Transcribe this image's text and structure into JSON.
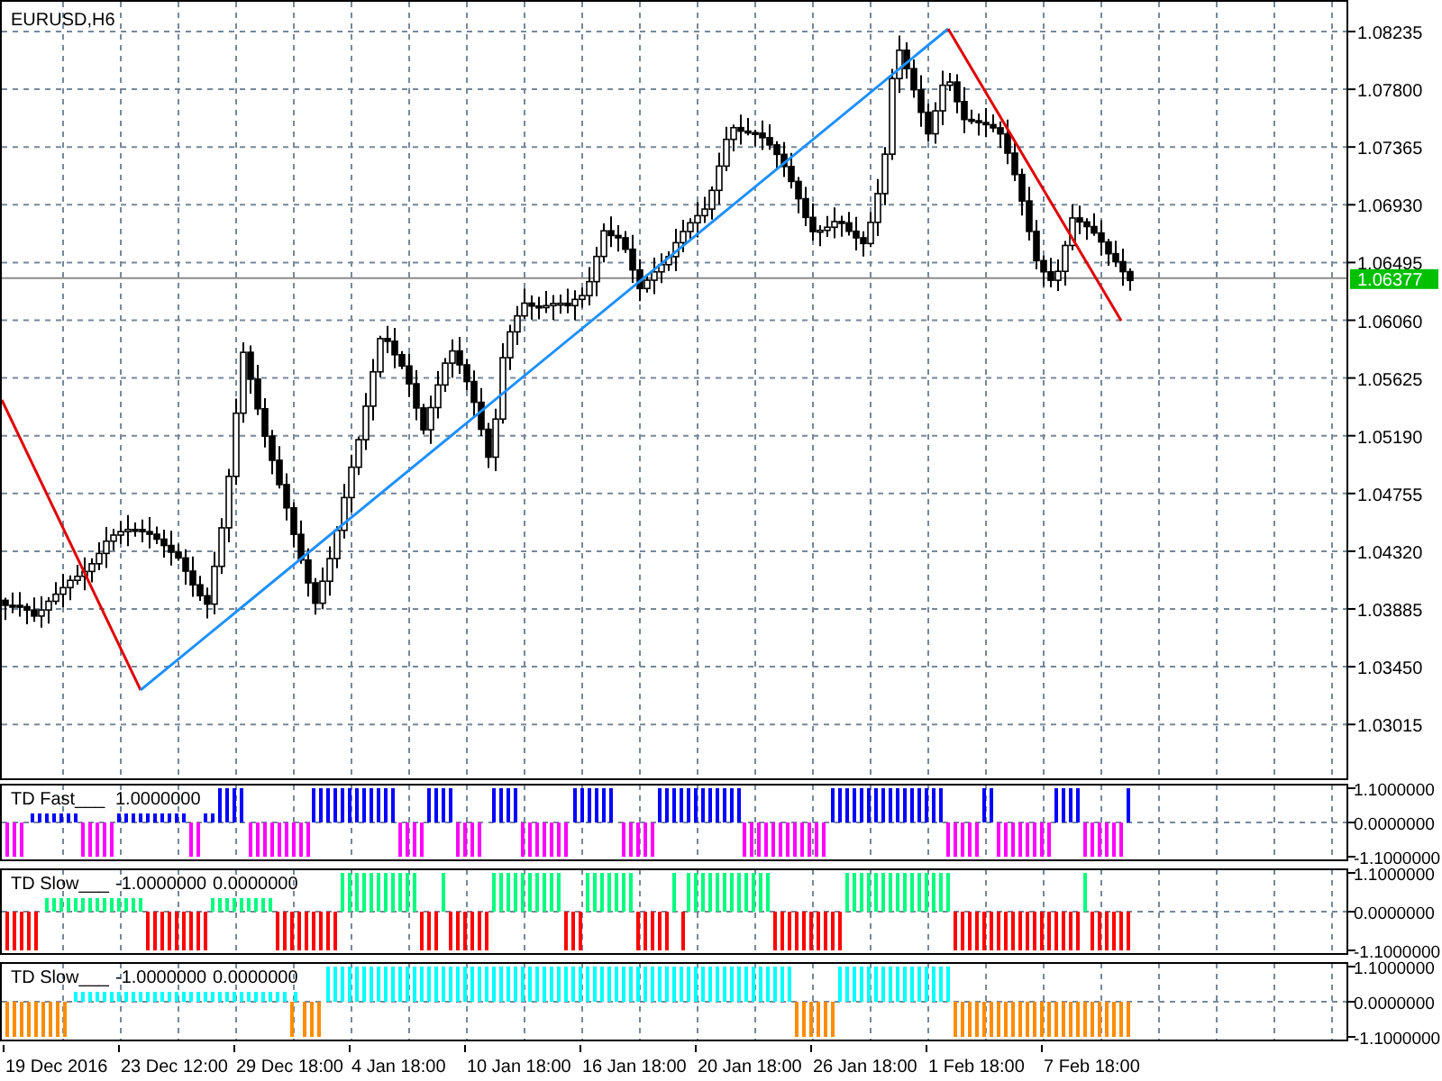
{
  "chart": {
    "title": "EURUSD,H6",
    "price_axis": [
      "1.08235",
      "1.07800",
      "1.07365",
      "1.06930",
      "1.06495",
      "1.06060",
      "1.05625",
      "1.05190",
      "1.04755",
      "1.04320",
      "1.03885",
      "1.03450",
      "1.03015"
    ],
    "current_price": "1.06377"
  },
  "indicators": [
    {
      "name": "TD Fast___",
      "values": [
        "1.0000000"
      ],
      "axis": [
        "1.1000000",
        "0.0000000",
        "-1.1000000"
      ]
    },
    {
      "name": "TD Slow___",
      "values": [
        "-1.0000000",
        "0.0000000"
      ],
      "axis": [
        "1.1000000",
        "0.0000000",
        "-1.1000000"
      ]
    },
    {
      "name": "TD Slow___",
      "values": [
        "-1.0000000",
        "0.0000000"
      ],
      "axis": [
        "1.1000000",
        "0.0000000",
        "-1.1000000"
      ]
    }
  ],
  "time_axis": [
    "19 Dec 2016",
    "23 Dec 12:00",
    "29 Dec 18:00",
    "4 Jan 18:00",
    "10 Jan 18:00",
    "16 Jan 18:00",
    "20 Jan 18:00",
    "26 Jan 18:00",
    "1 Feb 18:00",
    "7 Feb 18:00"
  ]
}
